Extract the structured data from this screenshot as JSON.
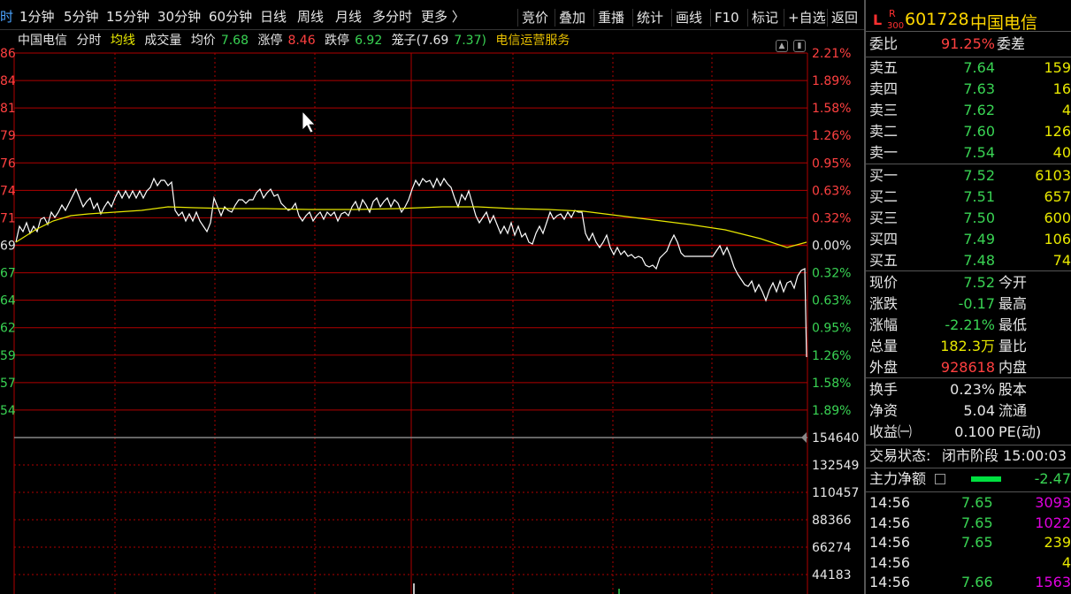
{
  "toolbar": {
    "periods": [
      {
        "label": "时",
        "active": true
      },
      {
        "label": "1分钟"
      },
      {
        "label": "5分钟"
      },
      {
        "label": "15分钟"
      },
      {
        "label": "30分钟"
      },
      {
        "label": "60分钟"
      },
      {
        "label": "日线"
      },
      {
        "label": "周线"
      },
      {
        "label": "月线"
      },
      {
        "label": "多分时"
      },
      {
        "label": "更多 〉"
      }
    ],
    "tools": [
      "竞价",
      "叠加",
      "重播",
      "统计",
      "画线",
      "F10",
      "标记",
      "+自选",
      "返回"
    ]
  },
  "chart": {
    "name": "中国电信",
    "mode": "分时",
    "avg_line_label": "均线",
    "volume_label": "成交量",
    "avg_price_label": "均价",
    "avg_price": "7.68",
    "limit_up_label": "涨停",
    "limit_up": "8.46",
    "limit_down_label": "跌停",
    "limit_down": "6.92",
    "cage_label": "笼子(7.69",
    "cage_value": "7.37)",
    "industry": "电信运营服务",
    "left_prices": [
      "86",
      "84",
      "81",
      "79",
      "76",
      "74",
      "71",
      "69",
      "67",
      "64",
      "62",
      "59",
      "57",
      "54"
    ],
    "right_pcts": [
      "2.21%",
      "1.89%",
      "1.58%",
      "1.26%",
      "0.95%",
      "0.63%",
      "0.32%",
      "0.00%",
      "0.32%",
      "0.63%",
      "0.95%",
      "1.26%",
      "1.58%",
      "1.89%"
    ],
    "vol_ticks": [
      "154640",
      "132549",
      "110457",
      "88366",
      "66274",
      "44183"
    ],
    "colors": {
      "grid": "#b00000",
      "price_line": "#ffffff",
      "avg_line": "#e8e800",
      "up": "#ff4040",
      "down": "#39d353"
    }
  },
  "stock": {
    "prefix": "L",
    "badge": "R",
    "index": "300",
    "code": "601728",
    "name": "中国电信"
  },
  "wei": {
    "label": "委比",
    "value": "91.25%",
    "diff_label": "委差"
  },
  "asks": [
    {
      "label": "卖五",
      "price": "7.64",
      "vol": "159"
    },
    {
      "label": "卖四",
      "price": "7.63",
      "vol": "16"
    },
    {
      "label": "卖三",
      "price": "7.62",
      "vol": "4"
    },
    {
      "label": "卖二",
      "price": "7.60",
      "vol": "126"
    },
    {
      "label": "卖一",
      "price": "7.54",
      "vol": "40"
    }
  ],
  "bids": [
    {
      "label": "买一",
      "price": "7.52",
      "vol": "6103"
    },
    {
      "label": "买二",
      "price": "7.51",
      "vol": "657"
    },
    {
      "label": "买三",
      "price": "7.50",
      "vol": "600"
    },
    {
      "label": "买四",
      "price": "7.49",
      "vol": "106"
    },
    {
      "label": "买五",
      "price": "7.48",
      "vol": "74"
    }
  ],
  "quote": [
    {
      "label": "现价",
      "value": "7.52",
      "label2": "今开",
      "color": "#39d353"
    },
    {
      "label": "涨跌",
      "value": "-0.17",
      "label2": "最高",
      "color": "#39d353"
    },
    {
      "label": "涨幅",
      "value": "-2.21%",
      "label2": "最低",
      "color": "#39d353"
    },
    {
      "label": "总量",
      "value": "182.3万",
      "label2": "量比",
      "color": "#e8e800"
    },
    {
      "label": "外盘",
      "value": "928618",
      "label2": "内盘",
      "color": "#ff4040"
    }
  ],
  "shares": [
    {
      "label": "换手",
      "value": "0.23%",
      "label2": "股本",
      "color": "#e6e6e6"
    },
    {
      "label": "净资",
      "value": "5.04",
      "label2": "流通",
      "color": "#e6e6e6"
    },
    {
      "label": "收益㈠",
      "value": "0.100",
      "label2": "PE(动)",
      "color": "#e6e6e6"
    }
  ],
  "status": {
    "label": "交易状态:",
    "value": "闭市阶段 15:00:03"
  },
  "main_flow": {
    "label": "主力净额",
    "value": "-2.47"
  },
  "ticks": [
    {
      "time": "14:56",
      "price": "7.65",
      "vol": "3093",
      "color": "#e000e0"
    },
    {
      "time": "14:56",
      "price": "7.65",
      "vol": "1022",
      "color": "#e000e0"
    },
    {
      "time": "14:56",
      "price": "7.65",
      "vol": "239",
      "color": "#e8e800"
    },
    {
      "time": "14:56",
      "price": "",
      "vol": "4",
      "color": "#e8e800"
    },
    {
      "time": "14:56",
      "price": "7.66",
      "vol": "1563",
      "color": "#e000e0"
    }
  ]
}
